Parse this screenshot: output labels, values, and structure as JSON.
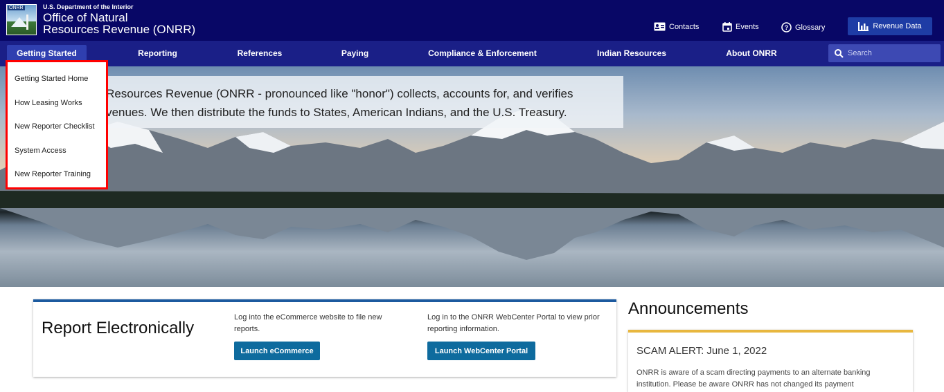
{
  "header": {
    "department": "U.S. Department of the Interior",
    "office_line1": "Office of Natural",
    "office_line2": "Resources Revenue (ONRR)",
    "logo_tag": "ONRR",
    "utility_links": [
      {
        "label": "Contacts",
        "icon": "contacts-card-icon"
      },
      {
        "label": "Events",
        "icon": "calendar-icon"
      },
      {
        "label": "Glossary",
        "icon": "help-circle-icon"
      }
    ],
    "revenue_button": {
      "label": "Revenue Data",
      "icon": "bar-chart-icon"
    }
  },
  "nav": {
    "items": [
      {
        "label": "Getting Started",
        "active": true
      },
      {
        "label": "Reporting"
      },
      {
        "label": "References"
      },
      {
        "label": "Paying"
      },
      {
        "label": "Compliance & Enforcement"
      },
      {
        "label": "Indian Resources"
      },
      {
        "label": "About ONRR"
      }
    ],
    "search_placeholder": "Search"
  },
  "dropdown": {
    "items": [
      "Getting Started Home",
      "How Leasing Works",
      "New Reporter Checklist",
      "System Access",
      "New Reporter Training"
    ],
    "highlight_color": "#ff0000"
  },
  "hero": {
    "mission_line1": "ural Resources Revenue (ONRR - pronounced like \"honor\") collects, accounts for, and verifies",
    "mission_line2": "al revenues. We then distribute the funds to States, American Indians, and the U.S. Treasury."
  },
  "report_card": {
    "title": "Report Electronically",
    "ecommerce_text": "Log into the eCommerce website to file new reports.",
    "ecommerce_button": "Launch eCommerce",
    "webcenter_text": "Log in to the ONRR WebCenter Portal to view prior reporting information.",
    "webcenter_button": "Launch WebCenter Portal"
  },
  "announcements": {
    "title": "Announcements",
    "item_heading": "SCAM ALERT: June 1, 2022",
    "item_text": "ONRR is aware of a scam directing payments to an alternate banking institution. Please be aware ONRR has not changed its payment"
  },
  "colors": {
    "topbar": "#080766",
    "nav": "#1a1f87",
    "button": "#0e6b9e",
    "card_accent": "#1c5a9f",
    "announcement_accent": "#e8b73f"
  }
}
